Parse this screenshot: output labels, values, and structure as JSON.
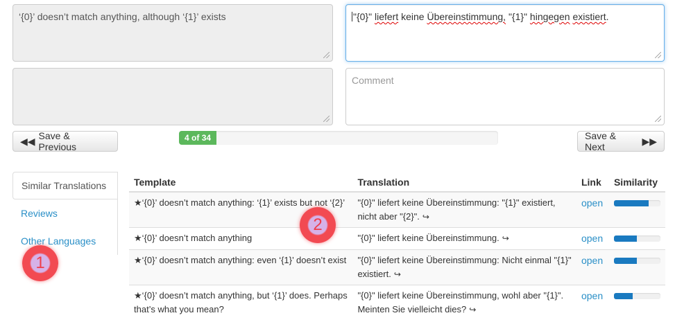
{
  "source": {
    "text": "‘{0}’ doesn’t match anything, although ‘{1}’ exists",
    "comment_text": ""
  },
  "translation": {
    "value_parts": [
      "\"{0}\" ",
      "liefert",
      " keine ",
      "Übereinstimmung,",
      " \"{1}\" ",
      "hingegen",
      " ",
      "existiert",
      "."
    ],
    "comment_placeholder": "Comment"
  },
  "navigation": {
    "save_previous_label": "Save & Previous",
    "save_next_label": "Save & Next",
    "progress_label": "4 of 34",
    "progress_current": 4,
    "progress_total": 34
  },
  "tabs": [
    {
      "label": "Similar Translations",
      "active": true
    },
    {
      "label": "Reviews",
      "active": false
    },
    {
      "label": "Other Languages",
      "active": false
    }
  ],
  "table": {
    "headers": [
      "Template",
      "Translation",
      "Link",
      "Similarity"
    ],
    "rows": [
      {
        "template": "‘{0}’ doesn’t match anything: ‘{1}’ exists but not ‘{2}’",
        "translation": "\"{0}\" liefert keine Übereinstimmung: \"{1}\" existiert, nicht aber \"{2}\".",
        "link": "open",
        "similarity": 0.75
      },
      {
        "template": "‘{0}’ doesn’t match anything",
        "translation": "\"{0}\" liefert keine Übereinstimmung.",
        "link": "open",
        "similarity": 0.5
      },
      {
        "template": "‘{0}’ doesn’t match anything: even ‘{1}’ doesn’t exist",
        "translation": "\"{0}\" liefert keine Übereinstimmung: Nicht einmal \"{1}\" existiert.",
        "link": "open",
        "similarity": 0.5
      },
      {
        "template": "‘{0}’ doesn’t match anything, but ‘{1}’ does. Perhaps that’s what you mean?",
        "translation": "\"{0}\" liefert keine Übereinstimmung, wohl aber \"{1}\". Meinten Sie vielleicht dies?",
        "link": "open",
        "similarity": 0.4
      }
    ]
  },
  "markers": [
    "1",
    "2"
  ],
  "icons": {
    "star": "star-icon",
    "external": "external-link-icon",
    "backward": "backward-icon",
    "forward": "forward-icon"
  }
}
